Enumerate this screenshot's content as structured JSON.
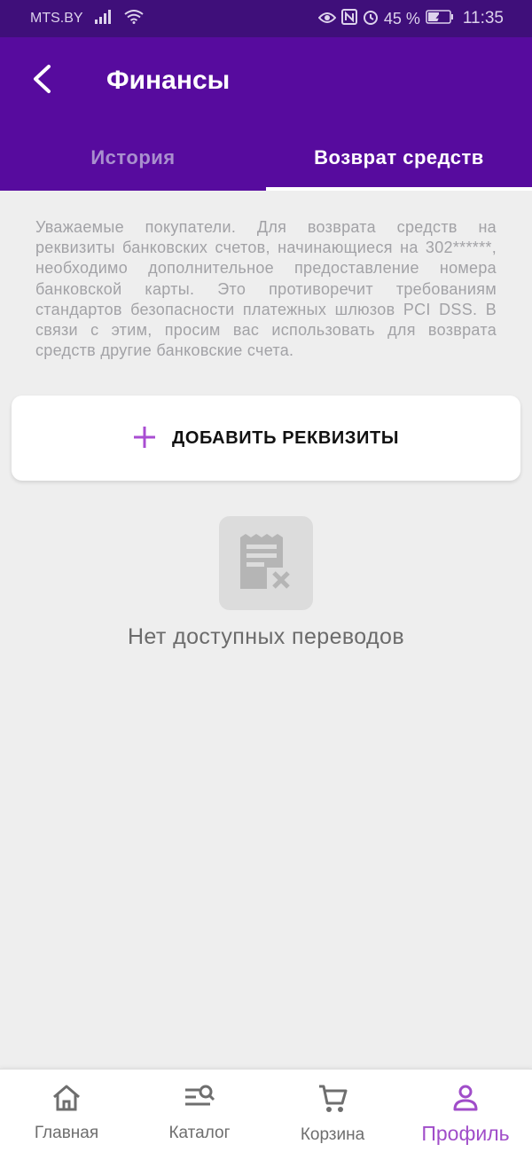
{
  "status": {
    "carrier": "MTS.BY",
    "battery": "45 %",
    "time": "11:35"
  },
  "header": {
    "title": "Финансы"
  },
  "tabs": [
    {
      "label": "История",
      "active": false
    },
    {
      "label": "Возврат средств",
      "active": true
    }
  ],
  "notice": "Уважаемые покупатели. Для возврата средств на реквизиты банковских счетов, начинающиеся на 302******, необходимо дополнительное предоставление номера банковской карты. Это противоречит требованиям стандартов безопасности платежных шлюзов PCI DSS. В связи с этим, просим вас использовать для возврата средств другие банковские счета.",
  "add_button": {
    "icon": "plus-icon",
    "label": "ДОБАВИТЬ РЕКВИЗИТЫ"
  },
  "empty_state": {
    "icon": "receipt-cancel-icon",
    "text": "Нет доступных переводов"
  },
  "bottom_nav": [
    {
      "label": "Главная",
      "icon": "home-icon",
      "active": false
    },
    {
      "label": "Каталог",
      "icon": "catalog-search-icon",
      "active": false
    },
    {
      "label": "Корзина",
      "icon": "cart-icon",
      "active": false
    },
    {
      "label": "Профиль",
      "icon": "profile-icon",
      "active": true
    }
  ],
  "colors": {
    "status_bar": "#3f0f7a",
    "primary": "#570b9e",
    "accent": "#a94dd2",
    "background": "#eeeeee"
  }
}
